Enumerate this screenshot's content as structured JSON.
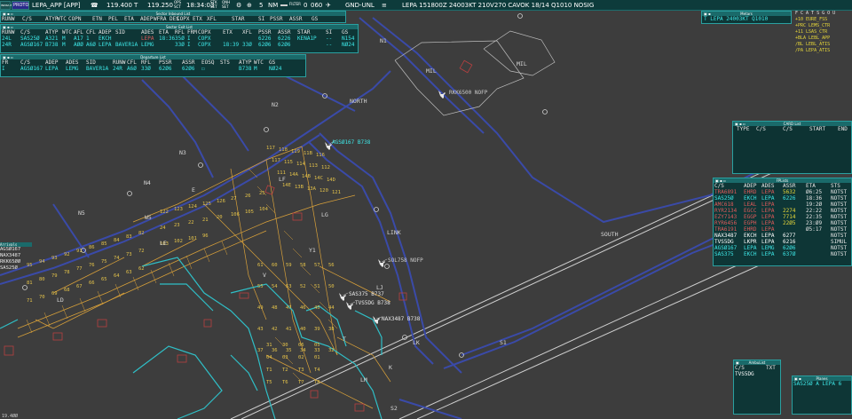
{
  "topbar": {
    "logo1": "INDRA PROTO",
    "logo2": "V",
    "mode": "PROTO",
    "sector": "LEPA_APP [APP]",
    "freq1": "119.400",
    "t_label": "T",
    "freq2": "119.250",
    "ops_label": "OPS",
    "ops_sub": "SCT",
    "time": "18:34:03",
    "stk_label": "STK",
    "stk_sub": "SET",
    "qnh_label": "QNH",
    "qnh_sub": "SET",
    "range": "5",
    "range_unit": "NM",
    "filter_label": "FILTER",
    "fl_low": "0",
    "fl_high": "060",
    "alt_filter": "GND-UNL",
    "metar": "LEPA 151800Z 24003KT 210V270 CAVOK 18/14 Q1010 NOSIG"
  },
  "arrival_list": {
    "title": "Sector Inbound List",
    "headers": [
      "RUNW",
      "C/S",
      "ATYP",
      "WTC",
      "COPN",
      "ETN",
      "PEL",
      "ETA",
      "ADEP",
      "WFRA",
      "DES",
      "COPX",
      "ETX",
      "XFL",
      "STAR",
      "SI",
      "PSSR",
      "ASSR",
      "GS"
    ]
  },
  "exit_list": {
    "title": "Sector Exit List",
    "headers": [
      "RUNW",
      "C/S",
      "ATYP",
      "WTC",
      "AFL",
      "CFL",
      "ADEP",
      "SID",
      "ADES",
      "ETA",
      "RFL",
      "FRM",
      "COPX",
      "ETX",
      "XFL",
      "PSSR",
      "ASSR",
      "STAR",
      "SI",
      "GS"
    ],
    "rows": [
      {
        "runw": "24L",
        "cs": "SAS25Ø",
        "atyp": "A321",
        "wtc": "M",
        "afl": "A17",
        "cfl": "1",
        "adep": "EKCH",
        "sid": "",
        "ades": "LEPA",
        "eta": "18:36",
        "rfl": "35Ø",
        "frm": "I",
        "copx": "COPX",
        "etx": "",
        "xfl": "",
        "pssr": "6226",
        "assr": "6226",
        "star": "KENA1P",
        "si": "--",
        "gs": "N154"
      },
      {
        "runw": "24R",
        "cs": "AGSØ167",
        "atyp": "B738",
        "wtc": "M",
        "afl": "AØØ",
        "cfl": "A6Ø",
        "adep": "LEPA",
        "sid": "BAVER1A",
        "ades": "LEMG",
        "eta": "",
        "rfl": "33Ø",
        "frm": "I",
        "copx": "COPX",
        "etx": "18:39",
        "xfl": "33Ø",
        "pssr": "62Ø6",
        "assr": "62Ø6",
        "star": "",
        "si": "--",
        "gs": "NØ24"
      }
    ]
  },
  "departure_list": {
    "title": "Departure List",
    "headers": [
      "FR",
      "C/S",
      "ADEP",
      "ADES",
      "SID",
      "RUNW",
      "CFL",
      "RFL",
      "PSSR",
      "ASSR",
      "EOSQ",
      "STS",
      "ATYP",
      "WTC",
      "GS"
    ],
    "rows": [
      {
        "fr": "I",
        "cs": "AGSØ167",
        "adep": "LEPA",
        "ades": "LEMG",
        "sid": "BAVER1A",
        "runw": "24R",
        "cfl": "A6Ø",
        "rfl": "33Ø",
        "pssr": "62Ø6",
        "assr": "62Ø6",
        "eosq": "☐",
        "sts": "",
        "atyp": "B738",
        "wtc": "M",
        "gs": "NØ24"
      }
    ]
  },
  "metars_win": {
    "title": "Metars",
    "text": "T LEPA 24003KT Q1010"
  },
  "freq_list": {
    "title": "F C A T S G O U",
    "items": [
      {
        "text": "+10 EURE_FSS",
        "color": "#e8d83a"
      },
      {
        "text": "+PRC LEMS_CTR",
        "color": "#e8d83a"
      },
      {
        "text": "+11 LSAS_CTR",
        "color": "#e8d83a"
      },
      {
        "text": "+BLA LEBL_APP",
        "color": "#e8d83a"
      },
      {
        "text": "/BL LEBL_ATIS",
        "color": "#e8d83a"
      },
      {
        "text": "/PA LEPA_ATIS",
        "color": "#e8d83a"
      }
    ]
  },
  "cardd_list": {
    "title": "CARD List",
    "headers": [
      "TYPE",
      "C/S",
      "C/S",
      "START",
      "END"
    ]
  },
  "fpl_list": {
    "title": "FPLists",
    "headers": [
      "C/S",
      "ADEP",
      "ADES",
      "ASSR",
      "ETA",
      "STS"
    ],
    "rows": [
      {
        "cs": "TRA6891",
        "adep": "EHRD",
        "ades": "LEPA",
        "assr": "5632",
        "eta": "Ø6:25",
        "sts": "NOTST",
        "color": "#e05a5a",
        "assr_color": "#e8d83a"
      },
      {
        "cs": "SAS25Ø",
        "adep": "EKCH",
        "ades": "LEPA",
        "assr": "6226",
        "eta": "18:36",
        "sts": "NOTST",
        "color": "#3ee8e8",
        "assr_color": "#3ee8e8"
      },
      {
        "cs": "AMC618",
        "adep": "LEAL",
        "ades": "LEPA",
        "assr": "",
        "eta": "19:2Ø",
        "sts": "NOTST",
        "color": "#e05a5a",
        "assr_color": "#e05a5a"
      },
      {
        "cs": "RYR2134",
        "adep": "EGCC",
        "ades": "LEPA",
        "assr": "2274",
        "eta": "22:22",
        "sts": "NOTST",
        "color": "#e05a5a",
        "assr_color": "#e8d83a"
      },
      {
        "cs": "EZY7143",
        "adep": "EGGP",
        "ades": "LEPA",
        "assr": "7714",
        "eta": "22:35",
        "sts": "NOTST",
        "color": "#e05a5a",
        "assr_color": "#e8d83a"
      },
      {
        "cs": "RYR6456",
        "adep": "EGPH",
        "ades": "LEPA",
        "assr": "22Ø5",
        "eta": "23:Ø9",
        "sts": "NOTST",
        "color": "#e05a5a",
        "assr_color": "#e8d83a"
      },
      {
        "cs": "TRA6191",
        "adep": "EHRD",
        "ades": "LEPA",
        "assr": "",
        "eta": "Ø5:17",
        "sts": "NOTST",
        "color": "#e05a5a",
        "assr_color": "#e05a5a"
      },
      {
        "cs": "NAX3487",
        "adep": "EKCH",
        "ades": "LEPA",
        "assr": "6277",
        "eta": "",
        "sts": "NOTST",
        "color": "#ffffff",
        "assr_color": "#ffffff"
      },
      {
        "cs": "TVS5DG",
        "adep": "LKPR",
        "ades": "LEPA",
        "assr": "6216",
        "eta": "",
        "sts": "SIMUL",
        "color": "#ffffff",
        "assr_color": "#ffffff"
      },
      {
        "cs": "AGSØ167",
        "adep": "LEPA",
        "ades": "LEMG",
        "assr": "62Ø6",
        "eta": "",
        "sts": "NOTST",
        "color": "#3ee8e8",
        "assr_color": "#3ee8e8"
      },
      {
        "cs": "SAS375",
        "adep": "EKCH",
        "ades": "LEPA",
        "assr": "637Ø",
        "eta": "",
        "sts": "NOTST",
        "color": "#3ee8e8",
        "assr_color": "#3ee8e8"
      }
    ]
  },
  "arrival_small": {
    "title": "Arrivals",
    "items": [
      "AGSØ167",
      "NAX3487",
      "RKK65ØØ",
      "SAS25Ø"
    ]
  },
  "ambulance": {
    "title": "AmbuList",
    "headers": [
      "C/S",
      "TXT"
    ],
    "rows": [
      "TVS5DG"
    ]
  },
  "plans": {
    "title": "Planes",
    "text": "SAS25Ø   A LEPA 6"
  },
  "bottom_left": "19.4ØØ",
  "map_labels": {
    "north": "NORTH",
    "south": "SOUTH",
    "link": "LINK",
    "mil1": "MIL",
    "mil2": "MIL",
    "n1": "N1",
    "n2": "N2",
    "n3": "N3",
    "n4": "N4",
    "n5": "N5",
    "s1": "S1",
    "s2": "S2",
    "e": "E",
    "ws": "W5",
    "ld": "LD",
    "lk": "LK",
    "lg": "LG",
    "lj": "LJ",
    "lm": "LM",
    "lf": "LF",
    "le": "LE",
    "k": "K",
    "v": "V",
    "t": "T",
    "y1": "Y1"
  },
  "targets": [
    {
      "label": "AGSØ167 B738",
      "color": "#3ee8e8"
    },
    {
      "label": "SOL758 NOFP",
      "color": "#cccccc"
    },
    {
      "label": "SAS375 B737",
      "color": "#e8e8e8"
    },
    {
      "label": "TVS5DG B738",
      "color": "#e8e8e8"
    },
    {
      "label": "NAX3487 B738",
      "color": "#e8e8e8"
    },
    {
      "label": "RKK6500 NOFP",
      "color": "#cccccc"
    }
  ],
  "stand_numbers_yellow": [
    "117",
    "118",
    "119",
    "11B",
    "116",
    "117",
    "115",
    "114",
    "113",
    "112",
    "111",
    "14A",
    "14B",
    "14C",
    "14D",
    "14E",
    "13B",
    "13A",
    "120",
    "121",
    "122",
    "123",
    "124",
    "125",
    "126",
    "27",
    "26",
    "25",
    "24",
    "23",
    "22",
    "21",
    "20",
    "106",
    "105",
    "104",
    "103",
    "102",
    "101",
    "96",
    "95",
    "94",
    "93",
    "92",
    "91",
    "86",
    "85",
    "84",
    "83",
    "82",
    "81",
    "80",
    "79",
    "78",
    "77",
    "76",
    "75",
    "74",
    "73",
    "72",
    "71",
    "70",
    "69",
    "68",
    "67",
    "66",
    "65",
    "64",
    "63",
    "62",
    "61",
    "60",
    "59",
    "58",
    "57",
    "56",
    "55",
    "54",
    "53",
    "52",
    "51",
    "50",
    "49",
    "48",
    "47",
    "46",
    "45",
    "44",
    "43",
    "42",
    "41",
    "40",
    "39",
    "38",
    "37",
    "36",
    "35",
    "34",
    "33",
    "32",
    "31",
    "30",
    "06",
    "05",
    "04",
    "03",
    "02",
    "01",
    "T1",
    "T2",
    "T3",
    "T4",
    "T5",
    "T6",
    "T7",
    "T8"
  ],
  "colors": {
    "background": "#3d3d3d",
    "taxiway": "#3a4aa8",
    "apron": "#d9a13a",
    "building": "#2fbfc7",
    "runway": "#d0d0d0",
    "window": "#0e3636",
    "window_border": "#2aa0a0"
  }
}
